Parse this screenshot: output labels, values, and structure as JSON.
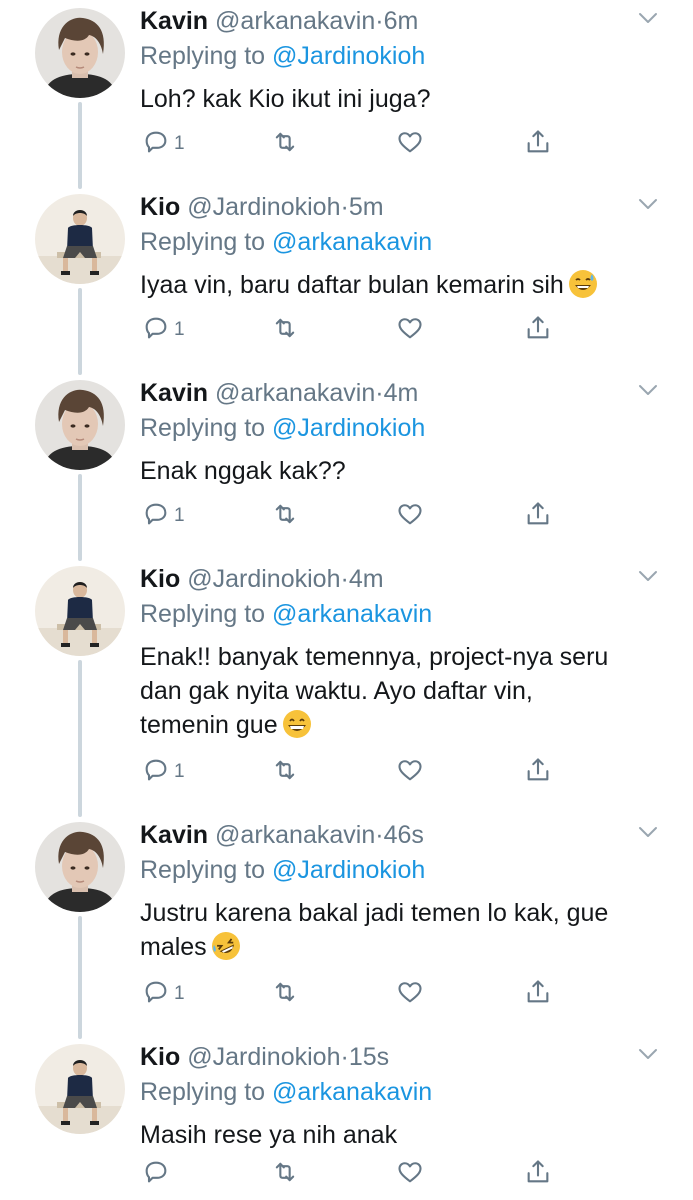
{
  "colors": {
    "accent": "#1b95e0",
    "muted": "#657786",
    "text": "#14171a",
    "thread": "#ccd6dd"
  },
  "tweets": [
    {
      "author": "kavin",
      "name": "Kavin",
      "handle": "@arkanakavin",
      "sep": "·",
      "time": "6m",
      "reply_prefix": "Replying to",
      "reply_to": "@Jardinokioh",
      "lines": [
        "Loh? kak Kio ikut ini juga?"
      ],
      "emoji": "",
      "reply_count": "1"
    },
    {
      "author": "kio",
      "name": "Kio",
      "handle": "@Jardinokioh",
      "sep": "·",
      "time": "5m",
      "reply_prefix": "Replying to",
      "reply_to": "@arkanakavin",
      "lines": [
        "Iyaa vin, baru daftar bulan kemarin sih"
      ],
      "emoji": "sweat-smile-emoji",
      "reply_count": "1"
    },
    {
      "author": "kavin",
      "name": "Kavin",
      "handle": "@arkanakavin",
      "sep": "·",
      "time": "4m",
      "reply_prefix": "Replying to",
      "reply_to": "@Jardinokioh",
      "lines": [
        "Enak nggak kak??"
      ],
      "emoji": "",
      "reply_count": "1"
    },
    {
      "author": "kio",
      "name": "Kio",
      "handle": "@Jardinokioh",
      "sep": "·",
      "time": "4m",
      "reply_prefix": "Replying to",
      "reply_to": "@arkanakavin",
      "lines": [
        "Enak!! banyak temennya, project-nya seru",
        "dan gak nyita waktu. Ayo daftar vin,",
        "temenin gue"
      ],
      "emoji": "grin-emoji",
      "reply_count": "1"
    },
    {
      "author": "kavin",
      "name": "Kavin",
      "handle": "@arkanakavin",
      "sep": "·",
      "time": "46s",
      "reply_prefix": "Replying to",
      "reply_to": "@Jardinokioh",
      "lines": [
        "Justru karena bakal jadi temen lo kak, gue",
        "males"
      ],
      "emoji": "rofl-emoji",
      "reply_count": "1"
    },
    {
      "author": "kio",
      "name": "Kio",
      "handle": "@Jardinokioh",
      "sep": "·",
      "time": "15s",
      "reply_prefix": "Replying to",
      "reply_to": "@arkanakavin",
      "lines": [
        "Masih rese ya nih anak"
      ],
      "emoji": "",
      "reply_count": ""
    }
  ]
}
